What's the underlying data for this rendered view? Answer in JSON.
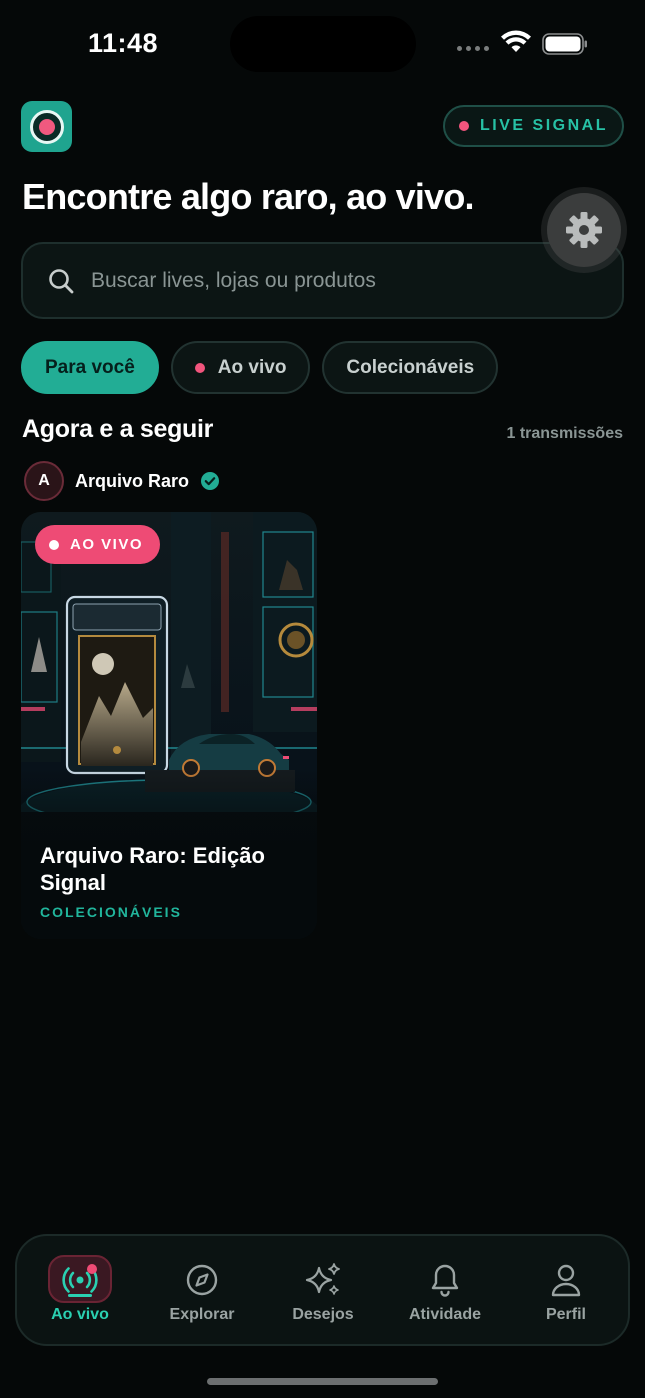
{
  "status_bar": {
    "time": "11:48"
  },
  "header": {
    "badge_label": "LIVE SIGNAL",
    "headline": "Encontre algo raro, ao vivo."
  },
  "search": {
    "placeholder": "Buscar lives, lojas ou produtos",
    "value": ""
  },
  "chips": [
    {
      "label": "Para você",
      "active": true
    },
    {
      "label": "Ao vivo",
      "active": false
    },
    {
      "label": "Colecionáveis",
      "active": false
    }
  ],
  "section": {
    "title": "Agora e a seguir",
    "count": "1 transmissões"
  },
  "seller": {
    "initial": "A",
    "name": "Arquivo Raro",
    "verified": true
  },
  "card": {
    "badge": "AO VIVO",
    "title": "Arquivo Raro: Edição Signal",
    "category": "COLECIONÁVEIS"
  },
  "tabbar": [
    {
      "label": "Ao vivo",
      "icon": "live-broadcast-icon",
      "active": true
    },
    {
      "label": "Explorar",
      "icon": "compass-icon",
      "active": false
    },
    {
      "label": "Desejos",
      "icon": "sparkles-icon",
      "active": false
    },
    {
      "label": "Atividade",
      "icon": "bell-icon",
      "active": false
    },
    {
      "label": "Perfil",
      "icon": "person-icon",
      "active": false
    }
  ],
  "colors": {
    "accent": "#22ad95",
    "live": "#ee4b75",
    "background": "#050808"
  }
}
